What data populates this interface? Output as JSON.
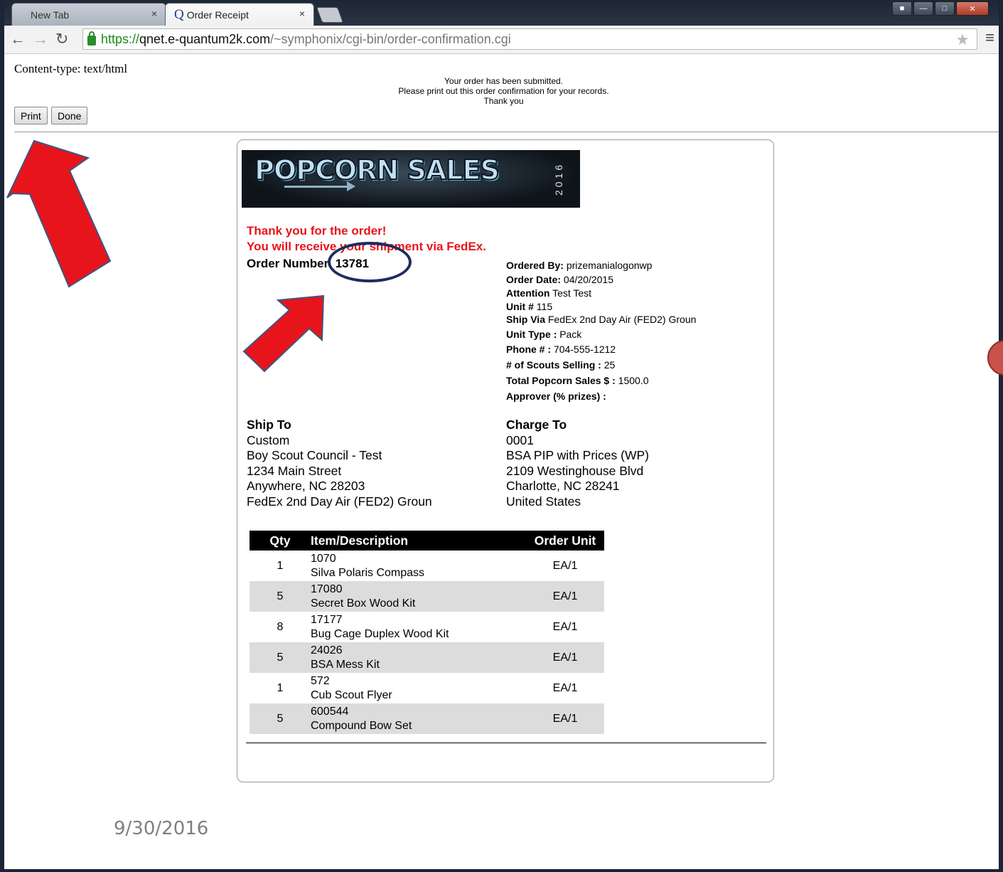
{
  "browser": {
    "tabs": [
      {
        "label": "New Tab",
        "active": false
      },
      {
        "label": "Order Receipt",
        "active": true
      }
    ],
    "close_glyph": "×",
    "url": {
      "scheme": "https://",
      "host": "qnet.e-quantum2k.com",
      "path": "/~symphonix/cgi-bin/order-confirmation.cgi"
    },
    "icons": [
      "back-icon",
      "forward-icon",
      "reload-icon",
      "lock-icon",
      "star-icon",
      "menu-icon"
    ]
  },
  "page": {
    "content_type": "Content-type: text/html",
    "notice_lines": [
      "Your order has been submitted.",
      "Please print out this order confirmation for your records.",
      "Thank you"
    ],
    "buttons": {
      "print": "Print",
      "done": "Done"
    }
  },
  "receipt": {
    "banner": {
      "title": "POPCORN SALES",
      "year": "2016"
    },
    "thank_you": "Thank you for the order!",
    "shipment_note": "You will receive your shipment via FedEx.",
    "order_number_label": "Order Number",
    "order_number": "13781",
    "details": [
      {
        "label": "Ordered By:",
        "value": "prizemanialogonwp"
      },
      {
        "label": "Order Date:",
        "value": "04/20/2015"
      },
      {
        "label": "Attention",
        "value": "Test Test"
      },
      {
        "label": "Unit #",
        "value": "115"
      },
      {
        "label": "Ship Via",
        "value": "FedEx 2nd Day Air (FED2) Groun"
      },
      {
        "label": "Unit Type :",
        "value": "Pack"
      },
      {
        "label": "Phone # :",
        "value": "704-555-1212"
      },
      {
        "label": "# of Scouts Selling :",
        "value": "25"
      },
      {
        "label": "Total Popcorn Sales $ :",
        "value": "1500.0"
      },
      {
        "label": "Approver (% prizes) :",
        "value": ""
      }
    ],
    "ship_to": {
      "heading": "Ship To",
      "lines": [
        "Custom",
        "Boy Scout Council - Test",
        "1234 Main Street",
        "Anywhere, NC 28203",
        "FedEx 2nd Day Air (FED2) Groun"
      ]
    },
    "charge_to": {
      "heading": "Charge To",
      "lines": [
        "0001",
        "BSA PIP with Prices (WP)",
        "2109 Westinghouse Blvd",
        "Charlotte, NC 28241",
        "United States"
      ]
    },
    "table": {
      "headers": {
        "qty": "Qty",
        "desc": "Item/Description",
        "unit": "Order Unit"
      },
      "rows": [
        {
          "qty": "1",
          "code": "1070",
          "desc": "Silva Polaris Compass",
          "unit": "EA/1"
        },
        {
          "qty": "5",
          "code": "17080",
          "desc": "Secret Box Wood Kit",
          "unit": "EA/1"
        },
        {
          "qty": "8",
          "code": "17177",
          "desc": "Bug Cage Duplex Wood Kit",
          "unit": "EA/1"
        },
        {
          "qty": "5",
          "code": "24026",
          "desc": "BSA Mess Kit",
          "unit": "EA/1"
        },
        {
          "qty": "1",
          "code": "572",
          "desc": "Cub Scout Flyer",
          "unit": "EA/1"
        },
        {
          "qty": "5",
          "code": "600544",
          "desc": "Compound Bow Set",
          "unit": "EA/1"
        }
      ]
    }
  },
  "slide_date": "9/30/2016",
  "annotations": {
    "arrow_color": "#e8141b",
    "circle_color": "#1d2d5e"
  }
}
